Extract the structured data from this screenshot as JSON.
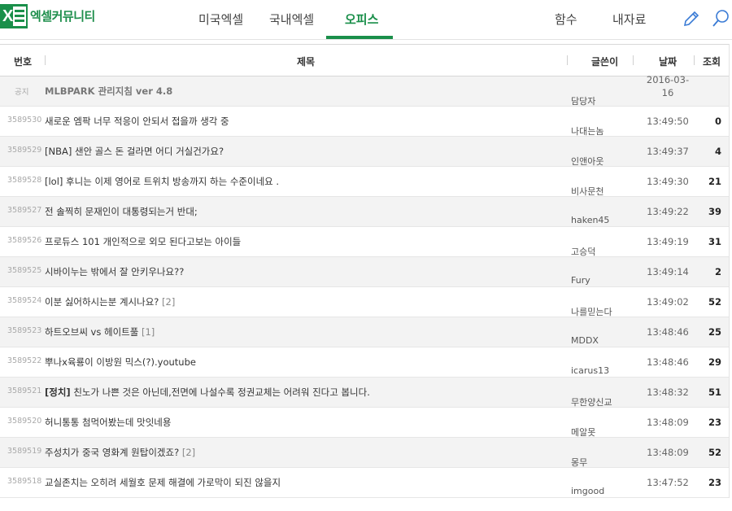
{
  "site": {
    "logo_text": "엑셀커뮤니티",
    "logo_letter": "X"
  },
  "nav": {
    "items": [
      {
        "label": "미국엑셀",
        "active": false
      },
      {
        "label": "국내엑셀",
        "active": false
      },
      {
        "label": "오피스",
        "active": true
      },
      {
        "label": "함수",
        "active": false
      },
      {
        "label": "내자료",
        "active": false
      }
    ]
  },
  "board": {
    "headers": {
      "num": "번호",
      "subject": "제목",
      "author": "글쓴이",
      "date": "날짜",
      "views": "조회"
    },
    "notice": {
      "num": "공지",
      "subject": "MLBPARK 관리지침 ver 4.8",
      "author": "담당자",
      "date": "2016-03-16",
      "views": ""
    },
    "rows": [
      {
        "num": "3589530",
        "subject": "새로운 엠팍 너무 적응이 안되서 접을까 생각 중",
        "tag": "",
        "comments": "",
        "author": "나대는놈",
        "date": "13:49:50",
        "views": "0"
      },
      {
        "num": "3589529",
        "subject": "[NBA] 샌안 골스 돈 걸라면 어디 거실건가요?",
        "tag": "",
        "comments": "",
        "author": "인앤아웃",
        "date": "13:49:37",
        "views": "4"
      },
      {
        "num": "3589528",
        "subject": "[lol] 후니는 이제 영어로 트위치 방송까지 하는 수준이네요 .",
        "tag": "",
        "comments": "",
        "author": "비사문천",
        "date": "13:49:30",
        "views": "21"
      },
      {
        "num": "3589527",
        "subject": "전 솔찍히 문재인이 대통령되는거 반대;",
        "tag": "",
        "comments": "",
        "author": "haken45",
        "date": "13:49:22",
        "views": "39"
      },
      {
        "num": "3589526",
        "subject": "프로듀스 101 개인적으로 외모 된다고보는 아이들",
        "tag": "",
        "comments": "",
        "author": "고승덕",
        "date": "13:49:19",
        "views": "31"
      },
      {
        "num": "3589525",
        "subject": "시바이누는 밖에서 잘 안키우나요??",
        "tag": "",
        "comments": "",
        "author": "Fury",
        "date": "13:49:14",
        "views": "2"
      },
      {
        "num": "3589524",
        "subject": "이분 싫어하시는분 계시나요?",
        "tag": "",
        "comments": "[2]",
        "author": "나를믿는다",
        "date": "13:49:02",
        "views": "52"
      },
      {
        "num": "3589523",
        "subject": "하트오브씨 vs 헤이트풀",
        "tag": "",
        "comments": "[1]",
        "author": "MDDX",
        "date": "13:48:46",
        "views": "25"
      },
      {
        "num": "3589522",
        "subject": "뿌나x육룡이 이방원 믹스(?).youtube",
        "tag": "",
        "comments": "",
        "author": "icarus13",
        "date": "13:48:46",
        "views": "29"
      },
      {
        "num": "3589521",
        "subject": " 친노가 나쁜 것은 아닌데,전면에 나설수록 정권교체는 어려워 진다고 봅니다.",
        "tag": "[정치]",
        "comments": "",
        "author": "무한양신교",
        "date": "13:48:32",
        "views": "51"
      },
      {
        "num": "3589520",
        "subject": "허니통통 첨먹어봤는데 맛잇네용",
        "tag": "",
        "comments": "",
        "author": "메알못",
        "date": "13:48:09",
        "views": "23"
      },
      {
        "num": "3589519",
        "subject": "주성치가 중국 영화계 원탑이겠죠?",
        "tag": "",
        "comments": "[2]",
        "author": "몽무",
        "date": "13:48:09",
        "views": "52"
      },
      {
        "num": "3589518",
        "subject": "교실존치는 오히려 세월호 문제 해결에 가로막이 되진 않을지",
        "tag": "",
        "comments": "",
        "author": "imgood",
        "date": "13:47:52",
        "views": "23"
      }
    ]
  },
  "icons": {
    "write": "pencil-icon",
    "search": "search-icon"
  },
  "colors": {
    "accent": "#1a8f4a",
    "row_alt": "#f3f3f3"
  }
}
